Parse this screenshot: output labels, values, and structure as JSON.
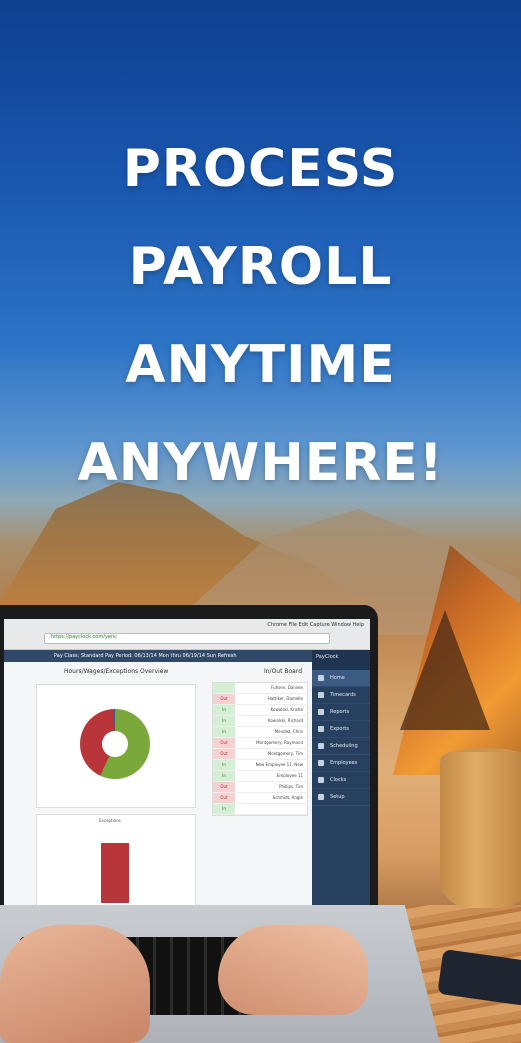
{
  "headline": [
    "PROCESS",
    "PAYROLL",
    "ANYTIME",
    "ANYWHERE!"
  ],
  "screen": {
    "url": "https://payclock.com/yenc",
    "menubar": "Chrome  File  Edit  Capture  Window  Help",
    "topbar": "Pay Class: Standard  Pay Period: 06/13/14 Mon thru 06/19/14 Sun   Refresh",
    "board_title": "In/Out Board",
    "chart_title": "Hours/Wages/Exceptions Overview",
    "exceptions_title": "Exceptions",
    "sidebar_items": [
      "Home",
      "Timecards",
      "Reports",
      "Exports",
      "Scheduling",
      "Employees",
      "Clocks",
      "Setup"
    ],
    "board_rows": [
      {
        "name": "Fuhsen, Daniele",
        "status": "Out"
      },
      {
        "name": "Hattiker, Damelle",
        "status": "In"
      },
      {
        "name": "Kowalski, Kristie",
        "status": "In"
      },
      {
        "name": "Kowalski, Richard",
        "status": "In"
      },
      {
        "name": "Mendez, Chris",
        "status": "Out"
      },
      {
        "name": "Montgomery, Raymond",
        "status": "Out"
      },
      {
        "name": "Montgomery, Tim",
        "status": "In"
      },
      {
        "name": "New Employee 11, New",
        "status": "In"
      },
      {
        "name": "Employee 11",
        "status": "Out"
      },
      {
        "name": "Phillips, Tim",
        "status": "Out"
      },
      {
        "name": "Schmidt, Angie",
        "status": "In"
      }
    ]
  },
  "colors": {
    "sky": "#1a58b0",
    "sidebar": "#28405f",
    "in": "#d5efd5",
    "out": "#f6d1d1",
    "donut_green": "#7aa83a",
    "donut_red": "#b8363a"
  }
}
